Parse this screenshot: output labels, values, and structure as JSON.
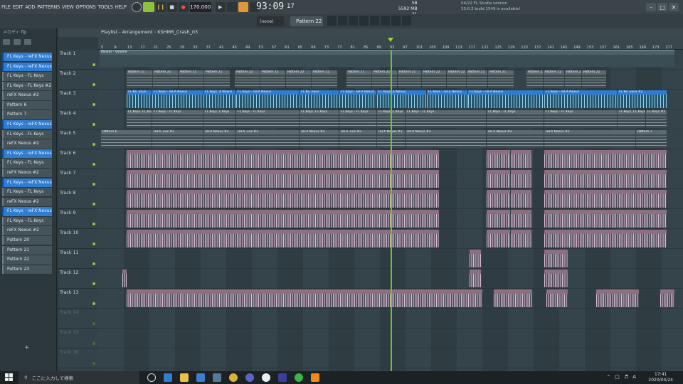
{
  "menu": [
    "FILE",
    "EDIT",
    "ADD",
    "PATTERNS",
    "VIEW",
    "OPTIONS",
    "TOOLS",
    "HELP"
  ],
  "transport": {
    "tempo": "170.000",
    "time": "93:09",
    "time_small": "17"
  },
  "system_monitor": {
    "cpu": "58",
    "memory": "5592 MB",
    "voices": "21"
  },
  "hint": {
    "line1": "04/22  FL Studio version",
    "line2": "20.6.2 build 1549 is available!"
  },
  "toolbar2": {
    "none_label": "(none)",
    "pattern_label": "Pattern 22"
  },
  "browser": {
    "head_label": "メロディ flp",
    "items": [
      {
        "label": "FL Keys - reFX Nexus",
        "color": "blue"
      },
      {
        "label": "FL Keys - reFX Nexus #2",
        "color": "blue"
      },
      {
        "label": "FL Keys - FL Keys",
        "color": "gray"
      },
      {
        "label": "FL Keys - FL Keys #2",
        "color": "gray"
      },
      {
        "label": "reFX Nexus #2",
        "color": "gray"
      },
      {
        "label": "Pattern 6",
        "color": "gray"
      },
      {
        "label": "Pattern 7",
        "color": "gray"
      },
      {
        "label": "FL Keys - reFX Nexus",
        "color": "blue"
      },
      {
        "label": "FL Keys - FL Keys",
        "color": "gray"
      },
      {
        "label": "reFX Nexus #2",
        "color": "gray"
      },
      {
        "label": "FL Keys - reFX Nexus",
        "color": "blue"
      },
      {
        "label": "FL Keys - FL Keys",
        "color": "gray"
      },
      {
        "label": "reFX Nexus #2",
        "color": "gray"
      },
      {
        "label": "FL Keys - reFX Nexus",
        "color": "blue"
      },
      {
        "label": "FL Keys - FL Keys",
        "color": "gray"
      },
      {
        "label": "reFX Nexus #2",
        "color": "gray"
      },
      {
        "label": "FL Keys - reFX Nexus",
        "color": "blue"
      },
      {
        "label": "FL Keys - FL Keys",
        "color": "gray"
      },
      {
        "label": "reFX Nexus #2",
        "color": "gray"
      },
      {
        "label": "Pattern 20",
        "color": "gray"
      },
      {
        "label": "Pattern 21",
        "color": "gray"
      },
      {
        "label": "Pattern 22",
        "color": "gray"
      },
      {
        "label": "Pattern 23",
        "color": "gray"
      }
    ]
  },
  "playlist": {
    "title": "Playlist - Arrangement",
    "separator": "›",
    "project": "KSHMR_Crash_03",
    "automation_label": "Master - Volume",
    "ruler": [
      "5",
      "9",
      "13",
      "17",
      "21",
      "25",
      "29",
      "33",
      "37",
      "41",
      "45",
      "49",
      "53",
      "57",
      "61",
      "65",
      "69",
      "73",
      "77",
      "81",
      "85",
      "89",
      "93",
      "97",
      "101",
      "105",
      "109",
      "113",
      "117",
      "121",
      "125",
      "129",
      "133",
      "137",
      "141",
      "145",
      "149",
      "153",
      "157",
      "161",
      "165",
      "169",
      "173",
      "177"
    ],
    "tracks": [
      "Track 1",
      "Track 2",
      "Track 3",
      "Track 4",
      "Track 5",
      "Track 6",
      "Track 7",
      "Track 8",
      "Track 9",
      "Track 10",
      "Track 11",
      "Track 12",
      "Track 13",
      "Track 14",
      "Track 15",
      "Track 16"
    ],
    "clip_labels": {
      "t2": [
        "Pattern 21",
        "Pattern 21",
        "Pattern 21",
        "Pattern 21",
        "Pattern 22",
        "Pattern 22",
        "Pattern 22",
        "Pattern 21",
        "Pattern 21",
        "Pattern 21",
        "Pattern 21",
        "Pattern 22",
        "Pattern 22",
        "Pattern 21",
        "Pattern 21",
        "Pattern 22",
        "Pattern 22",
        "Pattern 21",
        "Pattern 21"
      ],
      "t3": [
        "FL Ke..exus",
        "FL Keys - reFX Nexus",
        "FL Keys..X Nexus",
        "FL Keys - reFX Nexus",
        "FL Ke..exus",
        "FL Keys - reFX Nexus",
        "FL Keys..X Nexus",
        "FL Keys - reFX Nexus",
        "FL Keys - reFX Nexus",
        "FL Keys - reFX Nexus",
        "FL Ke..exus #2"
      ],
      "t4": [
        "FL Keys..FL Keys",
        "FL Keys - FL Keys",
        "FL Keys..L Keys",
        "FL Keys - FL Keys",
        "FL Keys..FL Keys",
        "FL Keys - FL Keys",
        "FL Keys..L Keys",
        "FL Keys - FL Keys",
        "FL Keys - FL Keys",
        "FL Keys - FL Keys",
        "FL Keys..FL Keys",
        "FL Keys #2"
      ],
      "t5": [
        "Pattern 6",
        "reFX..xus #2",
        "reFX Nexus #2",
        "reFX..xus #2",
        "reFX Nexus #2",
        "reFX..xus #2",
        "reFX Nexus #2",
        "reFX Nexus #2",
        "reFX Nexus #2",
        "reFX Nexus #2",
        "Pattern 7"
      ]
    }
  },
  "taskbar": {
    "search_placeholder": "ここに入力して検索",
    "time": "17:41",
    "date": "2020/04/24",
    "ime": "A"
  }
}
